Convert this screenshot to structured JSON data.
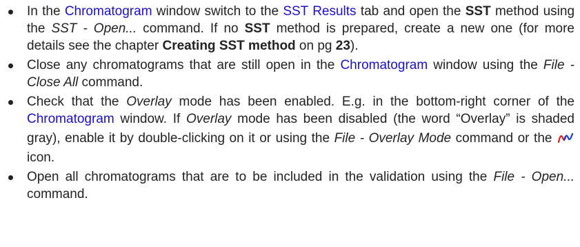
{
  "item1": {
    "t1": "In the ",
    "link_chromatogram": "Chromatogram",
    "t2": " window switch to the ",
    "link_sst_results": "SST Results",
    "t3": " tab and open the ",
    "b_sst1": "SST",
    "t4": " method using the ",
    "i_cmd": "SST - Open...",
    "t5": " command. If no ",
    "b_sst2": "SST",
    "t6": " method is prepared, create a new one (for more details see the chapter ",
    "b_chapter": "Creating SST method",
    "t7": " on pg ",
    "b_page": "23",
    "t8": ")."
  },
  "item2": {
    "t1": "Close any chromatograms that are still open in the ",
    "link_chromatogram": "Chromatogram",
    "t2": " window using the ",
    "i_cmd": "File - Close All",
    "t3": " command."
  },
  "item3": {
    "t1": "Check that the ",
    "i_overlay1": "Overlay",
    "t2": " mode has been enabled. E.g. in the bottom-right corner of the ",
    "link_chromatogram": "Chromatogram",
    "t3": " window. If ",
    "i_overlay2": "Overlay",
    "t4": " mode has been disabled (the word “Overlay” is shaded gray), enable it by double-clicking on it or using the ",
    "i_cmd": "File - Overlay Mode",
    "t5": " command or the ",
    "icon": "overlay-mode-icon",
    "t6": " icon."
  },
  "item4": {
    "t1": "Open all chromatograms that are to be included in the validation using the ",
    "i_cmd": "File - Open...",
    "t2": " command."
  },
  "colors": {
    "link": "#1a10c9",
    "text": "#222222",
    "icon_red": "#e0201a",
    "icon_blue": "#1a3fd0"
  }
}
